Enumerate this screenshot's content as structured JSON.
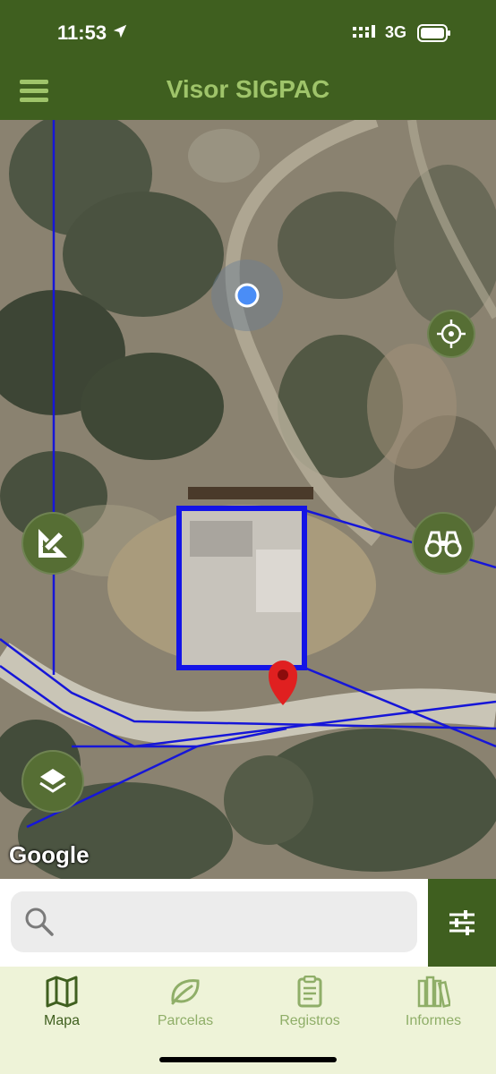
{
  "status_bar": {
    "time": "11:53",
    "network": "3G",
    "icons": [
      "location-arrow-icon",
      "signal-icon",
      "battery-icon"
    ]
  },
  "header": {
    "title": "Visor SIGPAC",
    "menu_icon": "hamburger-menu-icon"
  },
  "map": {
    "attribution": "Google",
    "controls": [
      "crosshair-locate-icon",
      "draw-measure-icon",
      "binoculars-icon",
      "layers-icon"
    ],
    "overlays": [
      "parcel-boundaries",
      "selected-parcel",
      "user-location-dot",
      "red-map-pin"
    ]
  },
  "search": {
    "placeholder": "",
    "value": ""
  },
  "tabs": [
    {
      "label": "Mapa",
      "icon": "map-icon",
      "active": true
    },
    {
      "label": "Parcelas",
      "icon": "leaf-icon",
      "active": false
    },
    {
      "label": "Registros",
      "icon": "clipboard-icon",
      "active": false
    },
    {
      "label": "Informes",
      "icon": "books-icon",
      "active": false
    }
  ],
  "colors": {
    "brand_dark": "#3f5f1f",
    "brand_light": "#9fc46a",
    "boundary": "#1616d8",
    "pin": "#e02020",
    "location": "#3b82f6",
    "tab_bg": "#eef3d8"
  }
}
